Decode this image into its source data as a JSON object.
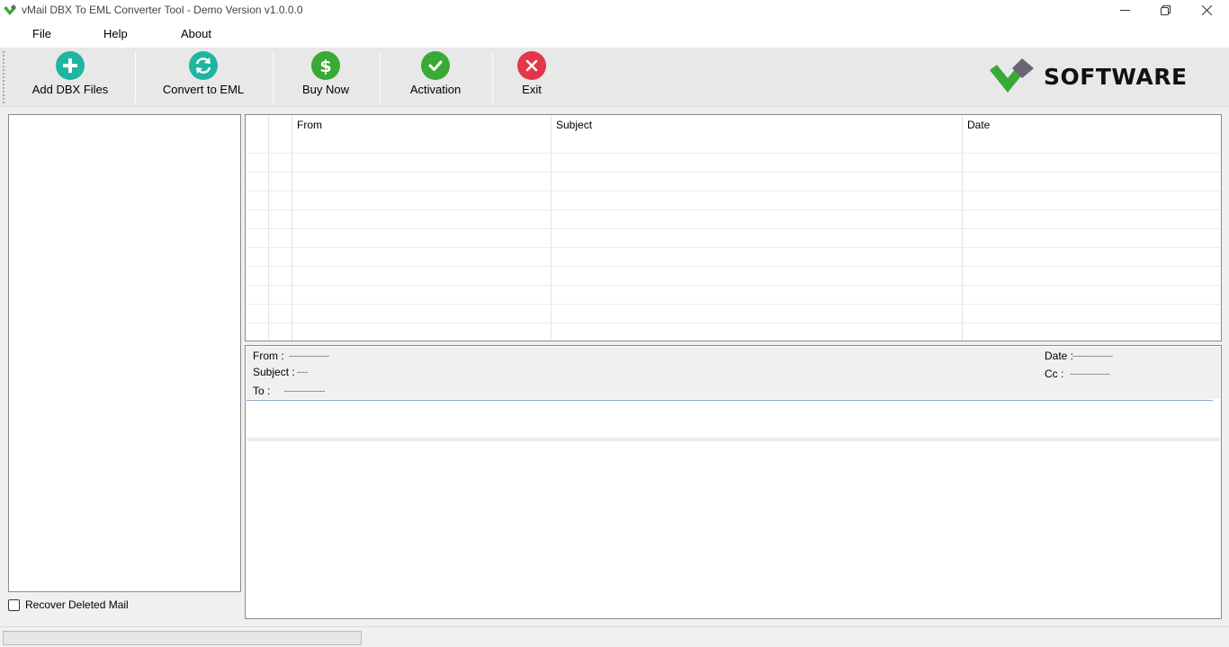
{
  "window": {
    "title": "vMail DBX To EML Converter Tool - Demo Version v1.0.0.0"
  },
  "menu": {
    "items": [
      {
        "label": "File"
      },
      {
        "label": "Help"
      },
      {
        "label": "About"
      }
    ]
  },
  "toolbar": {
    "add_label": "Add DBX Files",
    "convert_label": "Convert to EML",
    "buy_label": "Buy Now",
    "activation_label": "Activation",
    "exit_label": "Exit"
  },
  "brand": {
    "logo_text": "SOFTWARE",
    "colors": {
      "green": "#3aa935",
      "slate": "#6b6472",
      "teal": "#1fb5a3",
      "red": "#e3364a"
    }
  },
  "mail_grid": {
    "columns": [
      "From",
      "Subject",
      "Date"
    ],
    "rows": []
  },
  "preview": {
    "from_label": "From :",
    "from_value": "---------------",
    "subject_label": "Subject :",
    "subject_value": "----",
    "to_label": "To :",
    "to_value": "---------------",
    "date_label": "Date :",
    "date_value": "---------------",
    "cc_label": "Cc :",
    "cc_value": "---------------"
  },
  "options": {
    "recover_deleted_label": "Recover Deleted Mail",
    "recover_deleted_checked": false
  },
  "status": {
    "progress_percent": 0
  }
}
